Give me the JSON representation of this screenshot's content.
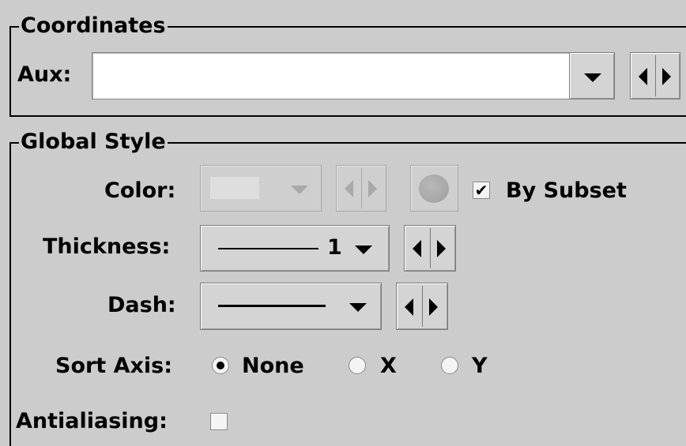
{
  "coordinates": {
    "title": "Coordinates",
    "aux_label": "Aux:",
    "aux_value": ""
  },
  "global_style": {
    "title": "Global Style",
    "color": {
      "label": "Color:",
      "by_subset_label": "By Subset",
      "by_subset_checked": true,
      "enabled": false
    },
    "thickness": {
      "label": "Thickness:",
      "value": "1"
    },
    "dash": {
      "label": "Dash:"
    },
    "sort_axis": {
      "label": "Sort Axis:",
      "options": [
        "None",
        "X",
        "Y"
      ],
      "selected": "None"
    },
    "antialiasing": {
      "label": "Antialiasing:",
      "checked": false
    }
  },
  "icons": {
    "dropdown": "chevron-down-icon",
    "prev": "arrow-left-icon",
    "next": "arrow-right-icon"
  },
  "colors": {
    "background": "#cccccc",
    "field": "#ffffff",
    "disabled_text": "#a9a9a9"
  }
}
